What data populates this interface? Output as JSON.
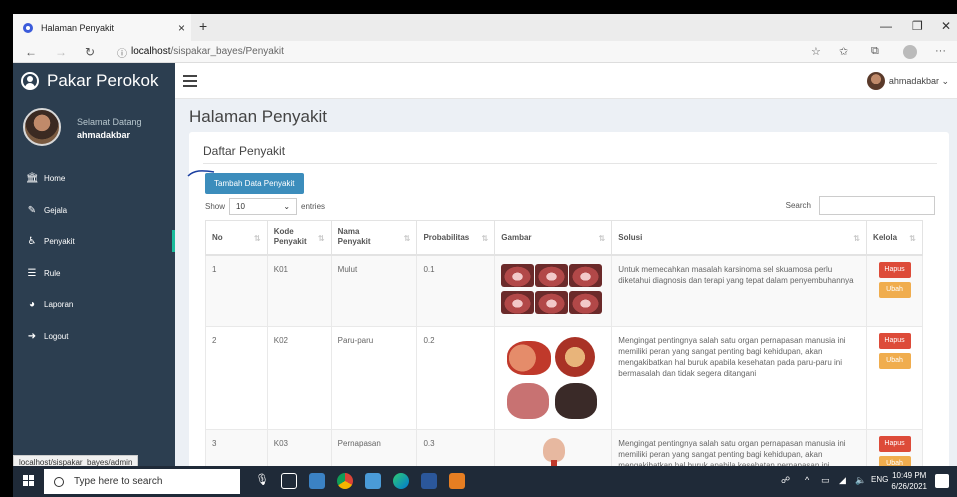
{
  "browser": {
    "tab_title": "Halaman Penyakit",
    "tab_close": "×",
    "new_tab": "+",
    "url_host": "localhost",
    "url_path": "/sispakar_bayes/Penyakit",
    "status_url": "localhost/sispakar_bayes/admin"
  },
  "app": {
    "brand": "Pakar Perokok",
    "user_menu": "ahmadakbar ⌄"
  },
  "sidebar": {
    "welcome": "Selamat Datang",
    "username": "ahmadakbar",
    "items": [
      {
        "label": "Home",
        "icon": "bank-icon"
      },
      {
        "label": "Gejala",
        "icon": "edit-icon"
      },
      {
        "label": "Penyakit",
        "icon": "wheelchair-icon"
      },
      {
        "label": "Rule",
        "icon": "list-icon"
      },
      {
        "label": "Laporan",
        "icon": "pie-chart-icon"
      },
      {
        "label": "Logout",
        "icon": "sign-out-icon"
      }
    ]
  },
  "main": {
    "page_title": "Halaman Penyakit",
    "box_title": "Daftar Penyakit",
    "add_button": "Tambah Data Penyakit",
    "show_label": "Show",
    "entries_value": "10",
    "entries_label": "entries",
    "search_label": "Search"
  },
  "table": {
    "headers": [
      "No",
      "Kode Penyakit",
      "Nama Penyakit",
      "Probabilitas",
      "Gambar",
      "Solusi",
      "Kelola"
    ],
    "rows": [
      {
        "no": "1",
        "kode": "K01",
        "nama": "Mulut",
        "prob": "0.1",
        "solusi": "Untuk memecahkan masalah karsinoma sel skuamosa perlu diketahui diagnosis dan terapi yang tepat dalam penyembuhannya"
      },
      {
        "no": "2",
        "kode": "K02",
        "nama": "Paru-paru",
        "prob": "0.2",
        "solusi": "Mengingat pentingnya salah satu organ pernapasan manusia ini memiliki peran yang sangat penting bagi kehidupan, akan mengakibatkan hal buruk apabila kesehatan pada paru-paru ini bermasalah dan tidak segera ditangani"
      },
      {
        "no": "3",
        "kode": "K03",
        "nama": "Pernapasan",
        "prob": "0.3",
        "solusi": "Mengingat pentingnya salah satu organ pernapasan manusia ini memiliki peran yang sangat penting bagi kehidupan, akan mengakibatkan hal buruk apabila kesehatan pernapasan ini bermasalah dan tidak segera ditangani"
      }
    ],
    "btn_hapus": "Hapus",
    "btn_ubah": "Ubah"
  },
  "taskbar": {
    "search_placeholder": "Type here to search",
    "lang": "ENG",
    "time": "10:49 PM",
    "date": "6/26/2021"
  },
  "colors": {
    "sidebar": "#2c3e50",
    "primary": "#3c8dbc",
    "danger": "#dd4b39",
    "warning": "#f0ad4e"
  }
}
